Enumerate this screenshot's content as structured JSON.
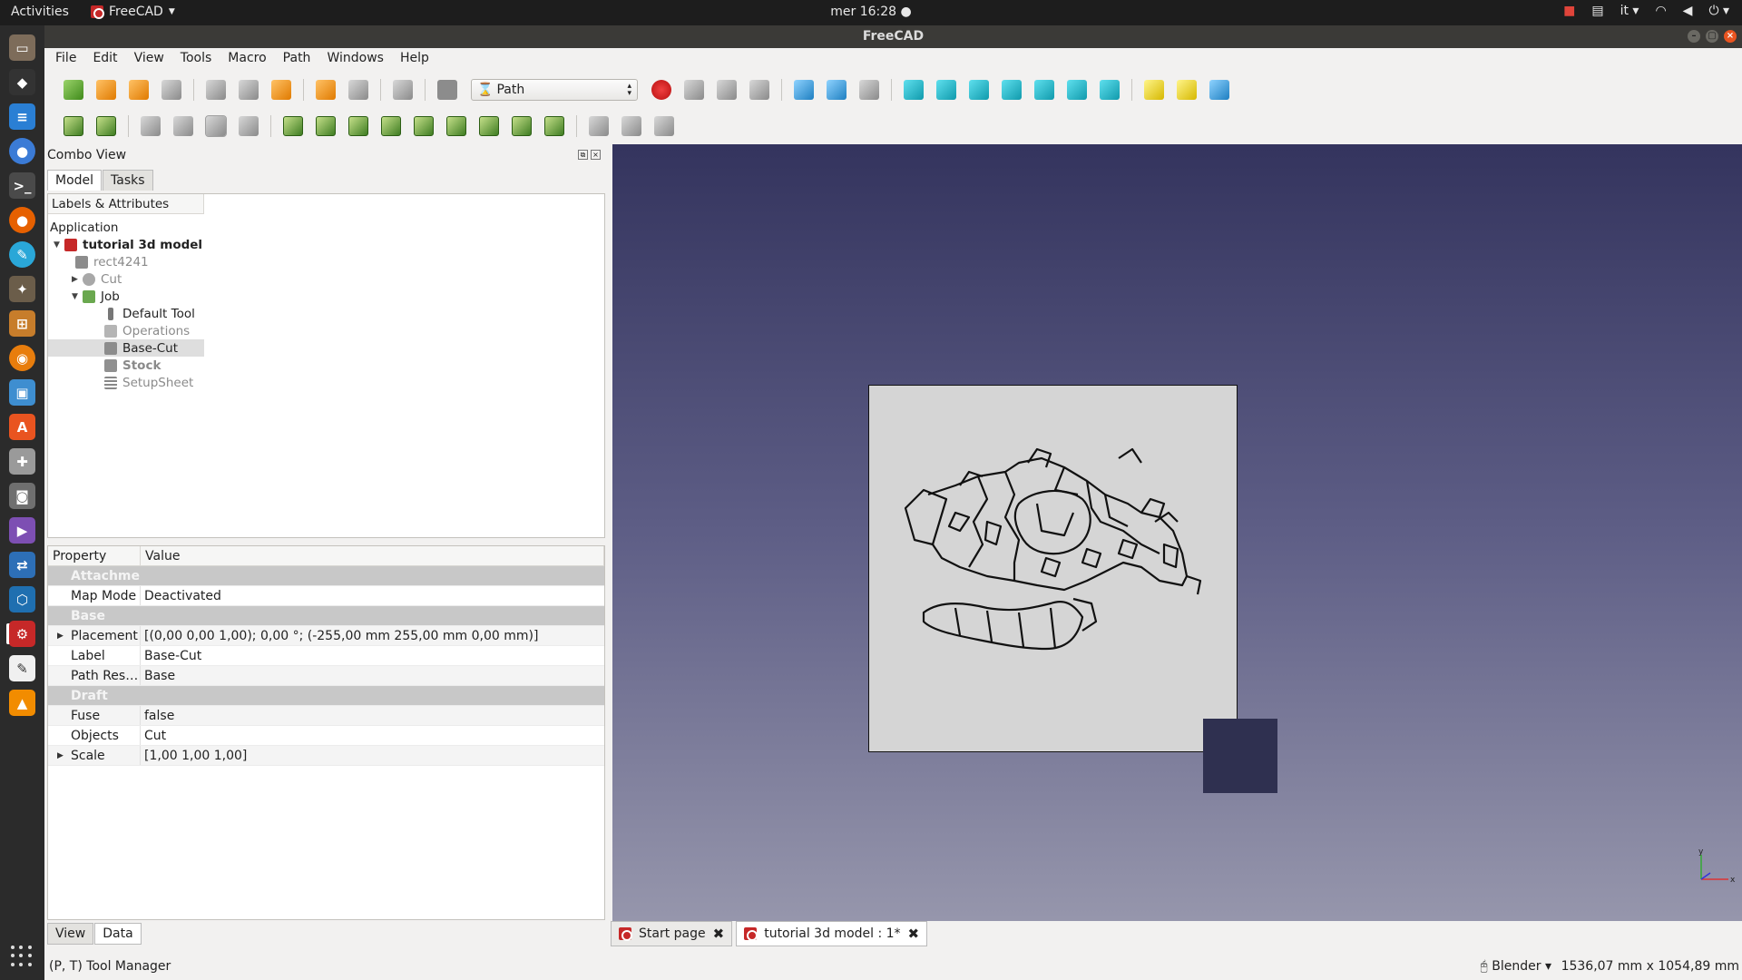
{
  "system_bar": {
    "activities": "Activities",
    "app_name": "FreeCAD",
    "clock": "mer 16:28",
    "lang": "it"
  },
  "window": {
    "title": "FreeCAD"
  },
  "menu": [
    "File",
    "Edit",
    "View",
    "Tools",
    "Macro",
    "Path",
    "Windows",
    "Help"
  ],
  "toolbar": {
    "workbench": "Path"
  },
  "combo_view": {
    "title": "Combo View",
    "tabs": [
      "Model",
      "Tasks"
    ],
    "tree_header": "Labels & Attributes",
    "tree": [
      {
        "label": "Application"
      },
      {
        "label": "tutorial 3d model"
      },
      {
        "label": "rect4241"
      },
      {
        "label": "Cut"
      },
      {
        "label": "Job"
      },
      {
        "label": "Default Tool"
      },
      {
        "label": "Operations"
      },
      {
        "label": "Base-Cut"
      },
      {
        "label": "Stock"
      },
      {
        "label": "SetupSheet"
      }
    ]
  },
  "property_editor": {
    "headers": [
      "Property",
      "Value"
    ],
    "rows": [
      {
        "name": "Attachment",
        "value": ""
      },
      {
        "name": "Map Mode",
        "value": "Deactivated"
      },
      {
        "name": "Base",
        "value": ""
      },
      {
        "name": "Placement",
        "value": "[(0,00 0,00 1,00); 0,00 °; (-255,00 mm  255,00 mm  0,00 mm)]"
      },
      {
        "name": "Label",
        "value": "Base-Cut"
      },
      {
        "name": "Path Res…",
        "value": "Base"
      },
      {
        "name": "Draft",
        "value": ""
      },
      {
        "name": "Fuse",
        "value": "false"
      },
      {
        "name": "Objects",
        "value": "Cut"
      },
      {
        "name": "Scale",
        "value": "[1,00 1,00 1,00]"
      }
    ],
    "tabs": [
      "View",
      "Data"
    ]
  },
  "doc_tabs": [
    {
      "label": "Start page"
    },
    {
      "label": "tutorial 3d model : 1*"
    }
  ],
  "status": {
    "message": "(P, T) Tool Manager",
    "navigation": "Blender",
    "dimensions": "1536,07 mm x 1054,89 mm"
  },
  "axes": {
    "x": "x",
    "y": "y"
  }
}
